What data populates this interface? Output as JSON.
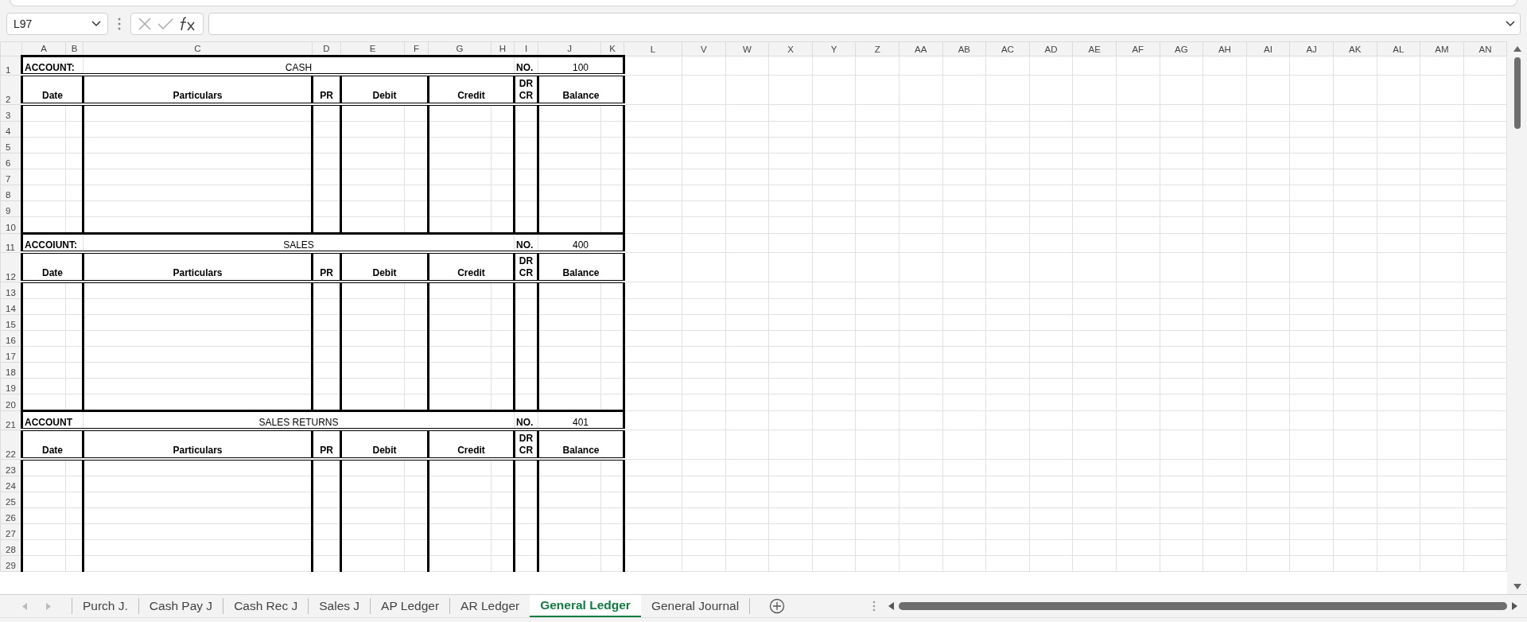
{
  "name_box": {
    "value": "L97"
  },
  "columns": [
    "A",
    "B",
    "C",
    "D",
    "E",
    "F",
    "G",
    "H",
    "I",
    "J",
    "K",
    "L",
    "V",
    "W",
    "X",
    "Y",
    "Z",
    "AA",
    "AB",
    "AC",
    "AD",
    "AE",
    "AF",
    "AG",
    "AH",
    "AI",
    "AJ",
    "AK",
    "AL",
    "AM",
    "AN"
  ],
  "ledgers": [
    {
      "title_row": "1",
      "header_row": "2",
      "account_label": "ACCOUNT:",
      "account_name": "CASH",
      "number_label": "NO.",
      "number": "100",
      "headers": [
        "Date",
        "Particulars",
        "PR",
        "Debit",
        "Credit",
        "DR\nCR",
        "Balance"
      ],
      "body_rows": [
        "3",
        "4",
        "5",
        "6",
        "7",
        "8",
        "9",
        "10"
      ]
    },
    {
      "title_row": "11",
      "header_row": "12",
      "account_label": "ACCOIUNT:",
      "account_name": "SALES",
      "number_label": "NO.",
      "number": "400",
      "headers": [
        "Date",
        "Particulars",
        "PR",
        "Debit",
        "Credit",
        "DR\nCR",
        "Balance"
      ],
      "body_rows": [
        "13",
        "14",
        "15",
        "16",
        "17",
        "18",
        "19",
        "20"
      ]
    },
    {
      "title_row": "21",
      "header_row": "22",
      "account_label": "ACCOUNT",
      "account_name": "SALES RETURNS",
      "number_label": "NO.",
      "number": "401",
      "headers": [
        "Date",
        "Particulars",
        "PR",
        "Debit",
        "Credit",
        "DR\nCR",
        "Balance"
      ],
      "body_rows": [
        "23",
        "24",
        "25",
        "26",
        "27",
        "28",
        "29"
      ]
    }
  ],
  "sheet_tabs": [
    {
      "label": "Purch J.",
      "selected": false
    },
    {
      "label": "Cash Pay J",
      "selected": false
    },
    {
      "label": "Cash Rec J",
      "selected": false
    },
    {
      "label": "Sales J",
      "selected": false
    },
    {
      "label": "AP Ledger",
      "selected": false
    },
    {
      "label": "AR Ledger",
      "selected": false
    },
    {
      "label": "General Ledger",
      "selected": true
    },
    {
      "label": "General Journal",
      "selected": false
    }
  ]
}
